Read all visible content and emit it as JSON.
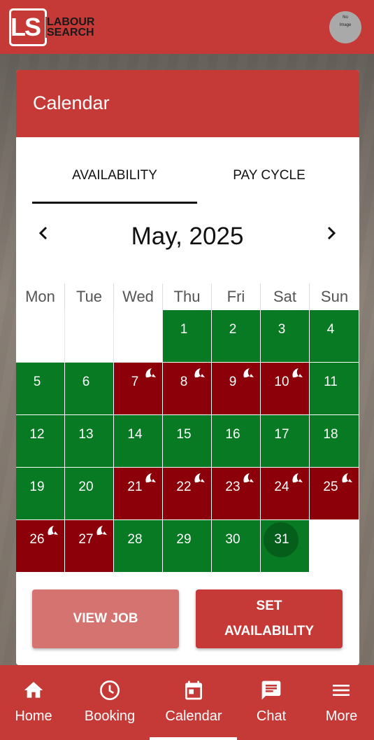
{
  "app": {
    "logo_short": "LS",
    "logo_text_line1": "LABOUR",
    "logo_text_line2": "SEARCH",
    "avatar_text_line1": "No",
    "avatar_text_line2": "Image"
  },
  "card": {
    "title": "Calendar"
  },
  "tabs": [
    {
      "label": "AVAILABILITY",
      "active": true
    },
    {
      "label": "PAY CYCLE",
      "active": false
    }
  ],
  "calendar": {
    "month_label": "May, 2025",
    "prev_symbol": "‹",
    "next_symbol": "›",
    "weekdays": [
      "Mon",
      "Tue",
      "Wed",
      "Thu",
      "Fri",
      "Sat",
      "Sun"
    ],
    "leading_blanks": 3,
    "days": [
      {
        "day": "1",
        "status": "available"
      },
      {
        "day": "2",
        "status": "available"
      },
      {
        "day": "3",
        "status": "available"
      },
      {
        "day": "4",
        "status": "available"
      },
      {
        "day": "5",
        "status": "available"
      },
      {
        "day": "6",
        "status": "available"
      },
      {
        "day": "7",
        "status": "unavailable"
      },
      {
        "day": "8",
        "status": "unavailable"
      },
      {
        "day": "9",
        "status": "unavailable"
      },
      {
        "day": "10",
        "status": "unavailable"
      },
      {
        "day": "11",
        "status": "available"
      },
      {
        "day": "12",
        "status": "available"
      },
      {
        "day": "13",
        "status": "available"
      },
      {
        "day": "14",
        "status": "available"
      },
      {
        "day": "15",
        "status": "available"
      },
      {
        "day": "16",
        "status": "available"
      },
      {
        "day": "17",
        "status": "available"
      },
      {
        "day": "18",
        "status": "available"
      },
      {
        "day": "19",
        "status": "available"
      },
      {
        "day": "20",
        "status": "available"
      },
      {
        "day": "21",
        "status": "unavailable"
      },
      {
        "day": "22",
        "status": "unavailable"
      },
      {
        "day": "23",
        "status": "unavailable"
      },
      {
        "day": "24",
        "status": "unavailable"
      },
      {
        "day": "25",
        "status": "unavailable"
      },
      {
        "day": "26",
        "status": "unavailable"
      },
      {
        "day": "27",
        "status": "unavailable"
      },
      {
        "day": "28",
        "status": "available"
      },
      {
        "day": "29",
        "status": "available"
      },
      {
        "day": "30",
        "status": "available"
      },
      {
        "day": "31",
        "status": "available",
        "today": true
      }
    ],
    "colors": {
      "available": "#077a23",
      "unavailable": "#8b0009",
      "today": "#055f1b"
    },
    "unavailable_icon": "moon-icon"
  },
  "actions": {
    "view_job": "VIEW JOB",
    "set_availability_line1": "SET",
    "set_availability_line2": "AVAILABILITY"
  },
  "nav": [
    {
      "label": "Home",
      "icon": "home-icon"
    },
    {
      "label": "Booking",
      "icon": "clock-icon"
    },
    {
      "label": "Calendar",
      "icon": "calendar-icon",
      "active": true
    },
    {
      "label": "Chat",
      "icon": "chat-icon"
    },
    {
      "label": "More",
      "icon": "menu-icon"
    }
  ],
  "theme": {
    "brand": "#c53a37",
    "brand_light": "#d4736f"
  }
}
